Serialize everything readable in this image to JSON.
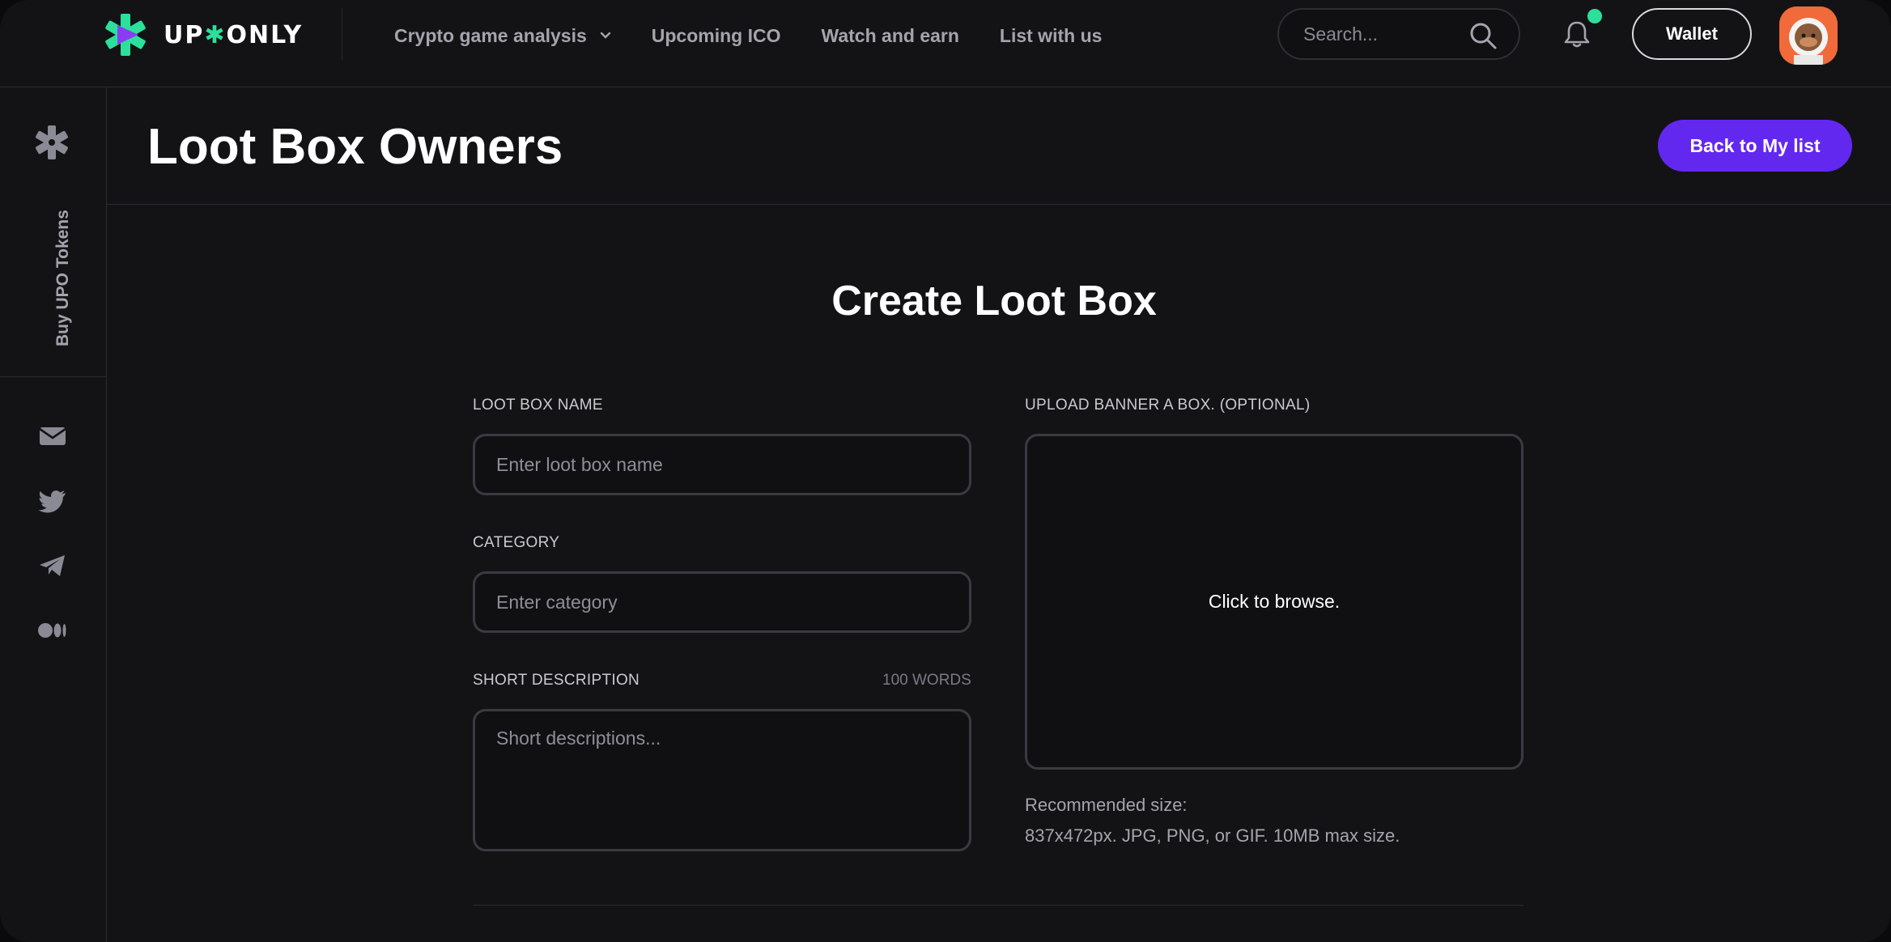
{
  "brand": {
    "wordmark_left": "UP",
    "wordmark_right": "ONLY",
    "accent": "#2be09a",
    "primary": "#6328f0"
  },
  "nav": {
    "items": [
      {
        "label": "Crypto game analysis",
        "has_dropdown": true
      },
      {
        "label": "Upcoming ICO"
      },
      {
        "label": "Watch and earn"
      },
      {
        "label": "List with us"
      }
    ]
  },
  "search": {
    "placeholder": "Search..."
  },
  "wallet": {
    "label": "Wallet"
  },
  "sidebar": {
    "buy_label": "Buy UPO Tokens",
    "social": [
      "mail-icon",
      "twitter-icon",
      "telegram-icon",
      "medium-icon"
    ]
  },
  "header": {
    "title": "Loot Box Owners",
    "back_label": "Back to My list"
  },
  "form": {
    "title": "Create Loot Box",
    "name_label": "LOOT BOX NAME",
    "name_placeholder": "Enter loot box name",
    "category_label": "CATEGORY",
    "category_placeholder": "Enter category",
    "description_label": "SHORT DESCRIPTION",
    "description_limit": "100 WORDS",
    "description_placeholder": "Short descriptions...",
    "upload_label": "UPLOAD BANNER A BOX. (OPTIONAL)",
    "upload_text": "Click to browse.",
    "recommended_title": "Recommended size:",
    "recommended_detail": "837x472px. JPG, PNG, or GIF. 10MB max size."
  }
}
